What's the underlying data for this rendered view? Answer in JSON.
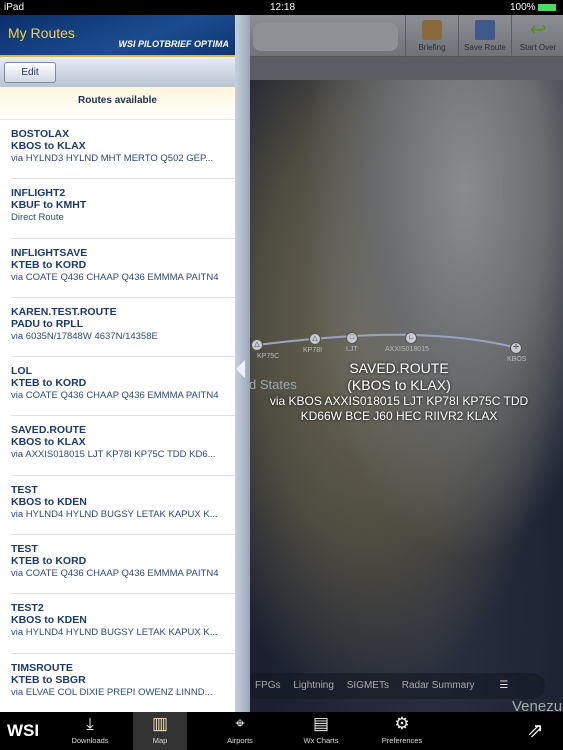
{
  "status": {
    "device": "iPad",
    "time": "12:18",
    "battery": "100%"
  },
  "panel": {
    "title": "My Routes",
    "brand": "WSI PILOTBRIEF OPTIMA",
    "edit_label": "Edit",
    "list_header": "Routes available",
    "routes": [
      {
        "name": "BOSTOLAX",
        "pair": "KBOS to KLAX",
        "via": "via HYLND3 HYLND MHT MERTO Q502 GEP..."
      },
      {
        "name": "INFLIGHT2",
        "pair": "KBUF to KMHT",
        "via": "Direct Route"
      },
      {
        "name": "INFLIGHTSAVE",
        "pair": "KTEB to KORD",
        "via": "via COATE Q436 CHAAP Q436 EMMMA PAITN4"
      },
      {
        "name": "KAREN.TEST.ROUTE",
        "pair": "PADU to RPLL",
        "via": "via 6035N/17848W 4637N/14358E"
      },
      {
        "name": "LOL",
        "pair": "KTEB to KORD",
        "via": "via COATE Q436 CHAAP Q436 EMMMA PAITN4"
      },
      {
        "name": "SAVED.ROUTE",
        "pair": "KBOS to KLAX",
        "via": "via AXXIS018015 LJT KP78I KP75C TDD KD6..."
      },
      {
        "name": "TEST",
        "pair": "KBOS to KDEN",
        "via": "via HYLND4 HYLND BUGSY LETAK KAPUX K..."
      },
      {
        "name": "TEST",
        "pair": "KTEB to KORD",
        "via": "via COATE Q436 CHAAP Q436 EMMMA PAITN4"
      },
      {
        "name": "TEST2",
        "pair": "KBOS to KDEN",
        "via": "via HYLND4 HYLND BUGSY LETAK KAPUX K..."
      },
      {
        "name": "TIMSROUTE",
        "pair": "KTEB to SBGR",
        "via": "via ELVAE COL DIXIE PREPI OWENZ LINND..."
      }
    ]
  },
  "toolbar": {
    "briefing": "Briefing",
    "save_route": "Save Route",
    "start_over": "Start Over"
  },
  "map": {
    "route_name": "SAVED.ROUTE",
    "route_pair": "(KBOS to KLAX)",
    "route_via_1": "via KBOS AXXIS018015 LJT KP78I KP75C TDD",
    "route_via_2": "KD66W BCE J60 HEC RIIVR2 KLAX",
    "waypoints": [
      "KP75C",
      "KP78I",
      "LJT",
      "AXXIS018015",
      "KBOS"
    ],
    "place_labels": [
      "d States",
      "Venezu"
    ],
    "layers": [
      "FPGs",
      "Lightning",
      "SIGMETs",
      "Radar Summary"
    ]
  },
  "tabbar": {
    "logo": "WSI",
    "tabs": [
      "Downloads",
      "Map",
      "Airports",
      "Wx Charts",
      "Preferences"
    ]
  }
}
